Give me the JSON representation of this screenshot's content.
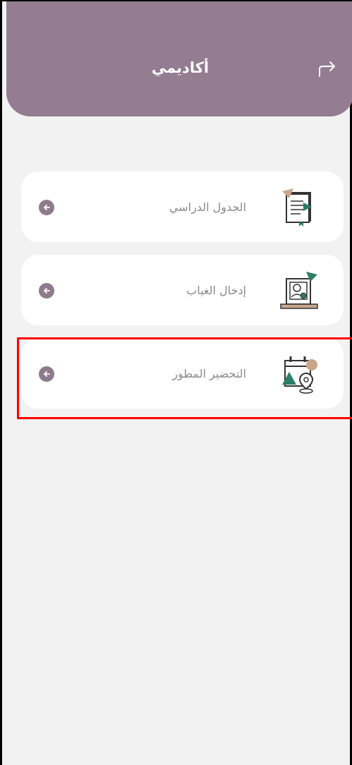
{
  "header": {
    "title": "أكاديمي"
  },
  "menu": {
    "items": [
      {
        "label": "الجدول الدراسي"
      },
      {
        "label": "إدخال الغياب"
      },
      {
        "label": "التحضير المطور"
      }
    ]
  },
  "colors": {
    "header_bg": "#947c91",
    "accent": "#8d7a8a",
    "highlight": "#ff0000",
    "icon_green": "#2e7d66",
    "icon_tan": "#c9a68a"
  },
  "icons": {
    "back": "arrow-right-curved-icon",
    "schedule": "schedule-book-icon",
    "absence": "absence-entry-icon",
    "attendance": "attendance-calendar-location-icon",
    "go": "arrow-left-circle-icon"
  }
}
